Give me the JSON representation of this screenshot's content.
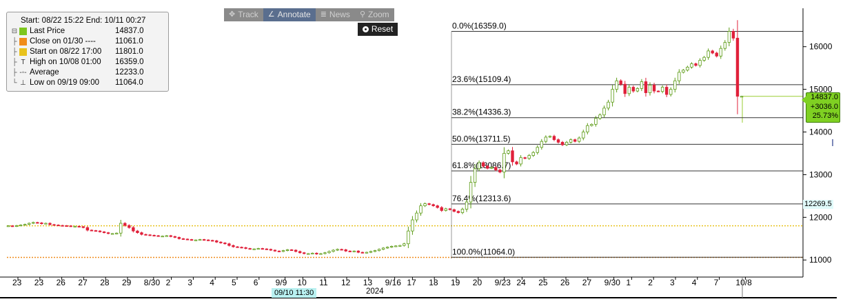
{
  "toolbar": {
    "buttons": [
      {
        "label": "Track",
        "icon": "crosshair-icon",
        "glyph": "✥",
        "active": false
      },
      {
        "label": "Annotate",
        "icon": "pencil-icon",
        "glyph": "∠",
        "active": true
      },
      {
        "label": "News",
        "icon": "news-icon",
        "glyph": "≣",
        "active": false
      },
      {
        "label": "Zoom",
        "icon": "magnifier-icon",
        "glyph": "⚲",
        "active": false
      }
    ],
    "reset_label": "Reset"
  },
  "legend": {
    "range": "Start: 08/22 15:22 End: 10/11 00:27",
    "rows": [
      {
        "label": "Last Price",
        "value": "14837.0",
        "color": "#7dc61e",
        "glyph": ""
      },
      {
        "label": "Close on 01/30 ----",
        "value": "11061.0",
        "color": "#f08c1a",
        "glyph": ""
      },
      {
        "label": "Start on 08/22 17:00",
        "value": "11801.0",
        "color": "#e8c21c",
        "glyph": ""
      },
      {
        "label": "High on 10/08 01:00",
        "value": "16359.0",
        "color": "#ffffff",
        "glyph": "T"
      },
      {
        "label": "Average",
        "value": "12233.0",
        "color": "#ffffff",
        "glyph": "-◦-"
      },
      {
        "label": "Low on 09/19 09:00",
        "value": "11064.0",
        "color": "#ffffff",
        "glyph": "⊥"
      }
    ]
  },
  "last_price_box": {
    "price": "14837.0",
    "change": "+3036.0",
    "pct": "25.73%"
  },
  "average_label": "12269.5",
  "cursor_label": "09/10 11:30",
  "year_label": "2024",
  "colors": {
    "up": "#7dc61e",
    "down": "#e0203a",
    "start_line": "#e8c21c",
    "close_line": "#f08c1a",
    "last_line": "#9acd32",
    "fib_line": "#333333"
  },
  "chart_data": {
    "type": "candlestick",
    "ylim": [
      10600,
      16900
    ],
    "yticks": [
      11000,
      12000,
      13000,
      14000,
      15000,
      16000
    ],
    "ytick_labels": [
      "11000",
      "12000",
      "13000",
      "14000",
      "15000",
      "16000"
    ],
    "xtick_labels": [
      "23",
      "23",
      "26",
      "27",
      "28",
      "29",
      "8/30",
      "2",
      "3",
      "4",
      "5",
      "6",
      "9/9",
      "10",
      "11",
      "12",
      "13",
      "9/16",
      "17",
      "18",
      "19",
      "20",
      "9/23",
      "24",
      "25",
      "26",
      "27",
      "9/30",
      "1",
      "2",
      "3",
      "4",
      "7",
      "10/8"
    ],
    "fibonacci": [
      {
        "label": "0.0%(16359.0)",
        "value": 16359.0
      },
      {
        "label": "23.6%(15109.4)",
        "value": 15109.4
      },
      {
        "label": "38.2%(14336.3)",
        "value": 14336.3
      },
      {
        "label": "50.0%(13711.5)",
        "value": 13711.5
      },
      {
        "label": "61.8%(13086.7)",
        "value": 13086.7
      },
      {
        "label": "76.4%(12313.6)",
        "value": 12313.6
      },
      {
        "label": "100.0%(11064.0)",
        "value": 11064.0
      }
    ],
    "reference_lines": {
      "start": 11801.0,
      "close": 11061.0,
      "last": 14837.0,
      "average": 12233.0,
      "high": 16359.0,
      "low": 11064.0
    },
    "closes": [
      11801,
      11790,
      11805,
      11820,
      11835,
      11860,
      11880,
      11870,
      11850,
      11860,
      11830,
      11820,
      11810,
      11805,
      11800,
      11790,
      11790,
      11780,
      11760,
      11700,
      11690,
      11680,
      11660,
      11640,
      11620,
      11620,
      11630,
      11860,
      11810,
      11760,
      11680,
      11640,
      11600,
      11590,
      11580,
      11570,
      11560,
      11560,
      11570,
      11550,
      11530,
      11500,
      11490,
      11480,
      11470,
      11470,
      11480,
      11470,
      11460,
      11450,
      11420,
      11400,
      11380,
      11340,
      11310,
      11300,
      11290,
      11270,
      11260,
      11260,
      11270,
      11260,
      11250,
      11230,
      11210,
      11200,
      11220,
      11240,
      11230,
      11200,
      11170,
      11150,
      11150,
      11160,
      11140,
      11150,
      11170,
      11200,
      11230,
      11250,
      11240,
      11210,
      11200,
      11210,
      11180,
      11170,
      11180,
      11200,
      11220,
      11250,
      11280,
      11300,
      11320,
      11330,
      11340,
      11380,
      11680,
      11940,
      12100,
      12270,
      12320,
      12300,
      12270,
      12230,
      12160,
      12200,
      12180,
      12140,
      12110,
      12190,
      12360,
      12820,
      13140,
      13280,
      13200,
      13150,
      13170,
      13110,
      13060,
      13500,
      13560,
      13300,
      13250,
      13400,
      13380,
      13450,
      13520,
      13640,
      13780,
      13880,
      13900,
      13820,
      13760,
      13700,
      13760,
      13820,
      13780,
      13860,
      14000,
      14150,
      14180,
      14320,
      14400,
      14560,
      14700,
      15000,
      15200,
      15120,
      14900,
      15050,
      14960,
      15020,
      15180,
      14920,
      15100,
      14960,
      14950,
      15050,
      14880,
      15000,
      15200,
      15400,
      15450,
      15520,
      15600,
      15560,
      15680,
      15750,
      15900,
      15850,
      15780,
      15960,
      16100,
      16359,
      16200,
      14837,
      14837
    ]
  }
}
